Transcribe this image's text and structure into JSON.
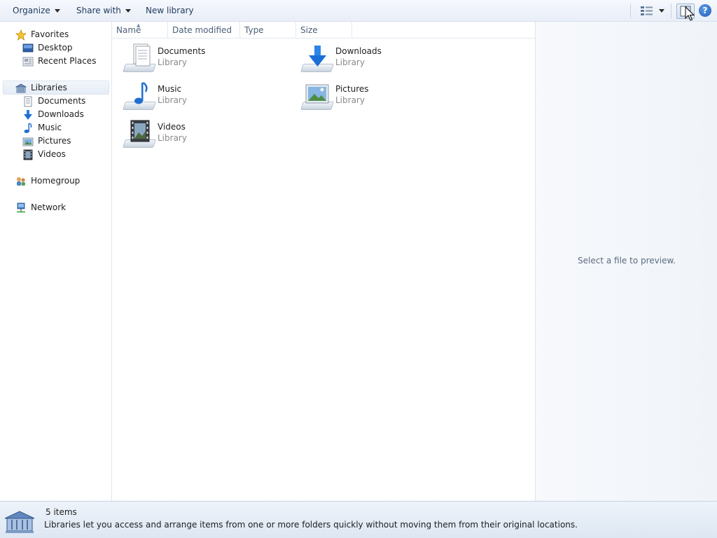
{
  "toolbar": {
    "organize_label": "Organize",
    "share_label": "Share with",
    "new_library_label": "New library"
  },
  "nav": {
    "favorites": "Favorites",
    "desktop": "Desktop",
    "recent_places": "Recent Places",
    "libraries": "Libraries",
    "documents": "Documents",
    "downloads": "Downloads",
    "music": "Music",
    "pictures": "Pictures",
    "videos": "Videos",
    "homegroup": "Homegroup",
    "network": "Network"
  },
  "columns": {
    "name": "Name",
    "date_modified": "Date modified",
    "type": "Type",
    "size": "Size"
  },
  "items": [
    {
      "name": "Documents",
      "type": "Library",
      "icon": "documents-library-icon"
    },
    {
      "name": "Downloads",
      "type": "Library",
      "icon": "downloads-library-icon"
    },
    {
      "name": "Music",
      "type": "Library",
      "icon": "music-library-icon"
    },
    {
      "name": "Pictures",
      "type": "Library",
      "icon": "pictures-library-icon"
    },
    {
      "name": "Videos",
      "type": "Library",
      "icon": "videos-library-icon"
    }
  ],
  "preview": {
    "empty_text": "Select a file to preview."
  },
  "details": {
    "count": "5 items",
    "description": "Libraries let you access and arrange items from one or more folders quickly without moving them from their original locations."
  },
  "colors": {
    "toolbar_text": "#1e395b",
    "accent_blue": "#1d72d8",
    "secondary_text": "#8a8a8a"
  }
}
